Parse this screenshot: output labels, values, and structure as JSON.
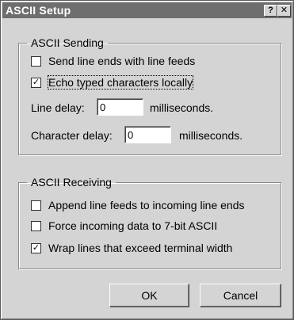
{
  "window": {
    "title": "ASCII Setup",
    "help_label": "?",
    "close_label": "✕"
  },
  "sending": {
    "legend": "ASCII Sending",
    "send_line_ends": {
      "label": "Send line ends with line feeds",
      "checked": false
    },
    "echo_typed": {
      "label": "Echo typed characters locally",
      "checked": true
    },
    "line_delay": {
      "label": "Line delay:",
      "value": "0",
      "unit": "milliseconds."
    },
    "character_delay": {
      "label": "Character delay:",
      "value": "0",
      "unit": "milliseconds."
    }
  },
  "receiving": {
    "legend": "ASCII Receiving",
    "append_line_feeds": {
      "label": "Append line feeds to incoming line ends",
      "checked": false
    },
    "force_7bit": {
      "label": "Force incoming data to 7-bit ASCII",
      "checked": false
    },
    "wrap_lines": {
      "label": "Wrap lines that exceed terminal width",
      "checked": true
    }
  },
  "buttons": {
    "ok": "OK",
    "cancel": "Cancel"
  },
  "check_mark": "✓"
}
